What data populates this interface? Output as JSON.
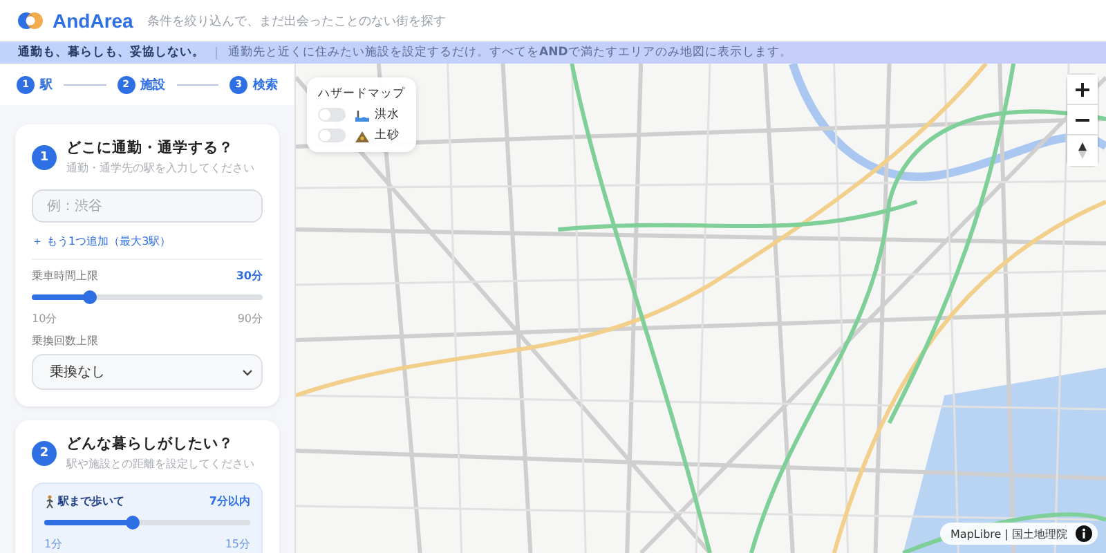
{
  "header": {
    "logo": "AndArea",
    "tagline": "条件を絞り込んで、まだ出会ったことのない街を探す"
  },
  "banner": {
    "headline": "通勤も、暮らしも、妥協しない。",
    "text": "通勤先と近くに住みたい施設を設定するだけ。すべてを**AND**で満たすエリアのみ地図に表示します。"
  },
  "steps": [
    {
      "number": "1",
      "label": "駅"
    },
    {
      "number": "2",
      "label": "施設"
    },
    {
      "number": "3",
      "label": "検索"
    }
  ],
  "commute": {
    "number": "1",
    "title": "どこに通勤・通学する？",
    "subtitle": "通勤・通学先の駅を入力してください",
    "station_field": {
      "placeholder": "例：渋谷"
    },
    "add_link": "＋ もう1つ追加（最大3駅）",
    "travel_time": {
      "label": "乗車時間上限",
      "value": "30分",
      "level": 0.25,
      "min": "10分",
      "max": "90分"
    },
    "transfers": {
      "label": "乗換回数上限",
      "value": "乗換なし"
    }
  },
  "lifestyle": {
    "number": "2",
    "title": "どんな暮らしがしたい？",
    "subtitle": "駅や施設との距離を設定してください",
    "walk": {
      "label": "駅まで歩いて",
      "value": "7分以内",
      "level": 0.43,
      "min": "1分",
      "max": "15分"
    }
  },
  "hazard": {
    "title": "ハザードマップ",
    "layers": [
      {
        "kind": "flood",
        "label": "洪水",
        "on": false
      },
      {
        "kind": "landslide",
        "label": "土砂",
        "on": false
      }
    ]
  },
  "attribution": "MapLibre | 国土地理院"
}
